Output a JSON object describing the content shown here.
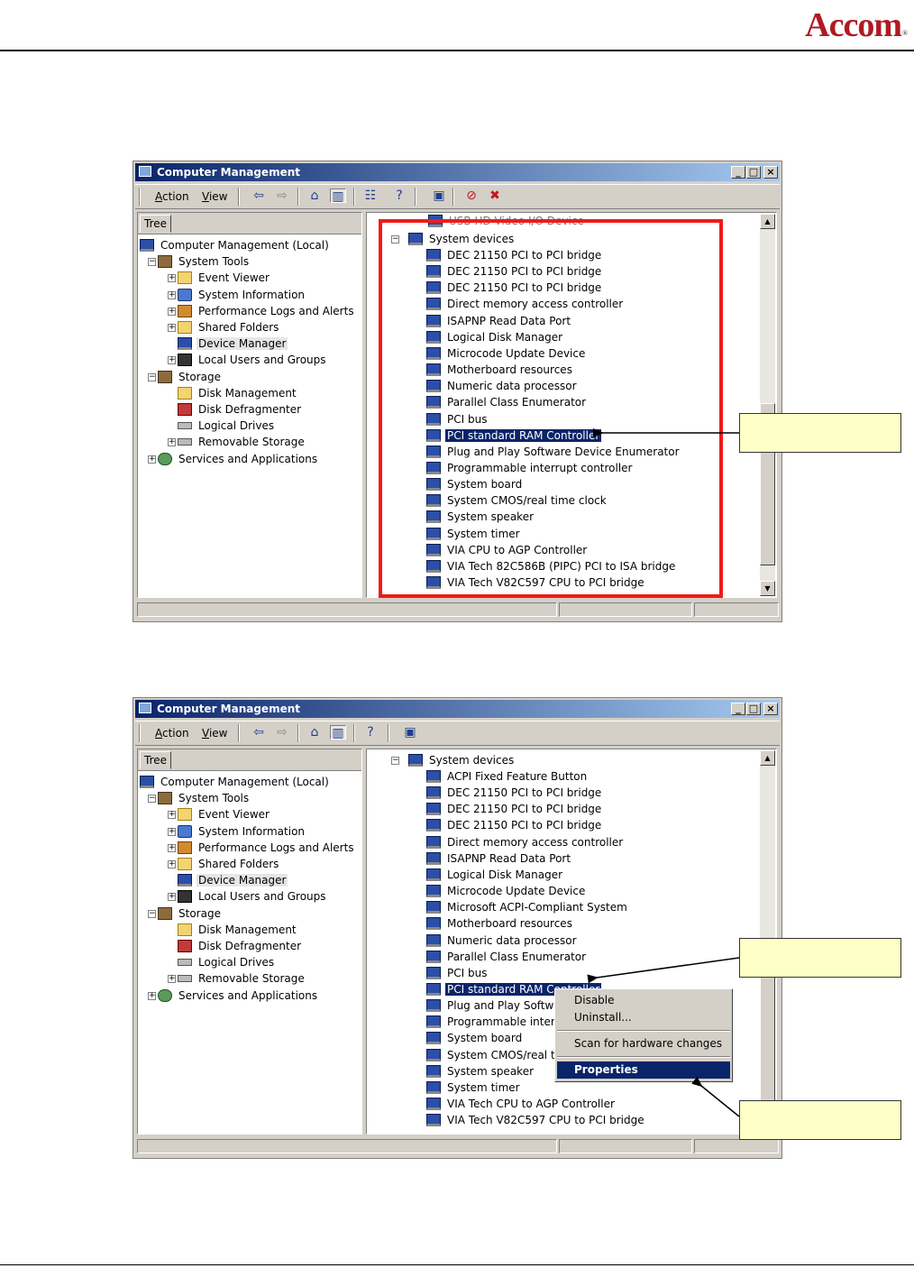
{
  "header": {
    "logo": "Accom",
    "logo_mark": "®"
  },
  "window": {
    "title": "Computer Management",
    "menu": [
      "Action",
      "View"
    ],
    "tree_tab": "Tree",
    "buttons": {
      "minimize": "_",
      "maximize": "□",
      "close": "×"
    }
  },
  "tree": [
    {
      "label": "Computer Management (Local)",
      "icon": "monitor-icon",
      "level": 0,
      "expander": ""
    },
    {
      "label": "System Tools",
      "icon": "tools-icon",
      "level": 1,
      "expander": "−"
    },
    {
      "label": "Event Viewer",
      "icon": "event-viewer-icon",
      "level": 2,
      "expander": "+"
    },
    {
      "label": "System Information",
      "icon": "system-information-icon",
      "level": 2,
      "expander": "+"
    },
    {
      "label": "Performance Logs and Alerts",
      "icon": "performance-icon",
      "level": 2,
      "expander": "+"
    },
    {
      "label": "Shared Folders",
      "icon": "folder-icon",
      "level": 2,
      "expander": "+"
    },
    {
      "label": "Device Manager",
      "icon": "device-manager-icon",
      "level": 2,
      "expander": "",
      "selected": true
    },
    {
      "label": "Local Users and Groups",
      "icon": "users-icon",
      "level": 2,
      "expander": "+"
    },
    {
      "label": "Storage",
      "icon": "storage-icon",
      "level": 1,
      "expander": "−"
    },
    {
      "label": "Disk Management",
      "icon": "folder-icon",
      "level": 2,
      "expander": ""
    },
    {
      "label": "Disk Defragmenter",
      "icon": "defragmenter-icon",
      "level": 2,
      "expander": ""
    },
    {
      "label": "Logical Drives",
      "icon": "drive-icon",
      "level": 2,
      "expander": ""
    },
    {
      "label": "Removable Storage",
      "icon": "removable-storage-icon",
      "level": 2,
      "expander": "+"
    },
    {
      "label": "Services and Applications",
      "icon": "services-icon",
      "level": 1,
      "expander": "+"
    }
  ],
  "screen1": {
    "top_partial": "USB HD Video I/O Device",
    "category": "System devices",
    "devices": [
      "DEC 21150 PCI to PCI bridge",
      "DEC 21150 PCI to PCI bridge",
      "DEC 21150 PCI to PCI bridge",
      "Direct memory access controller",
      "ISAPNP Read Data Port",
      "Logical Disk Manager",
      "Microcode Update Device",
      "Motherboard resources",
      "Numeric data processor",
      "Parallel Class Enumerator",
      "PCI bus",
      "PCI standard RAM Controller",
      "Plug and Play Software Device Enumerator",
      "Programmable interrupt controller",
      "System board",
      "System CMOS/real time clock",
      "System speaker",
      "System timer",
      "VIA CPU to AGP Controller",
      "VIA Tech 82C586B (PIPC) PCI to ISA bridge",
      "VIA Tech V82C597 CPU to PCI bridge"
    ],
    "highlighted_index": 11
  },
  "screen2": {
    "category": "System devices",
    "devices": [
      "ACPI Fixed Feature Button",
      "DEC 21150 PCI to PCI bridge",
      "DEC 21150 PCI to PCI bridge",
      "DEC 21150 PCI to PCI bridge",
      "Direct memory access controller",
      "ISAPNP Read Data Port",
      "Logical Disk Manager",
      "Microcode Update Device",
      "Microsoft ACPI-Compliant System",
      "Motherboard resources",
      "Numeric data processor",
      "Parallel Class Enumerator",
      "PCI bus",
      "PCI standard RAM Controller",
      "Plug and Play Software Device Enumerator",
      "Programmable interrupt controller",
      "System board",
      "System CMOS/real time clock",
      "System speaker",
      "System timer",
      "VIA Tech CPU to AGP Controller",
      "VIA Tech V82C597 CPU to PCI bridge"
    ],
    "highlighted_index": 13,
    "context_menu": {
      "items": [
        "Disable",
        "Uninstall...",
        "Scan for hardware changes",
        "Properties"
      ],
      "active": "Properties"
    }
  },
  "colors": {
    "accent": "#0a246a",
    "redbox": "#f21a1a",
    "callout": "#ffffc8",
    "logo": "#b01a22"
  }
}
